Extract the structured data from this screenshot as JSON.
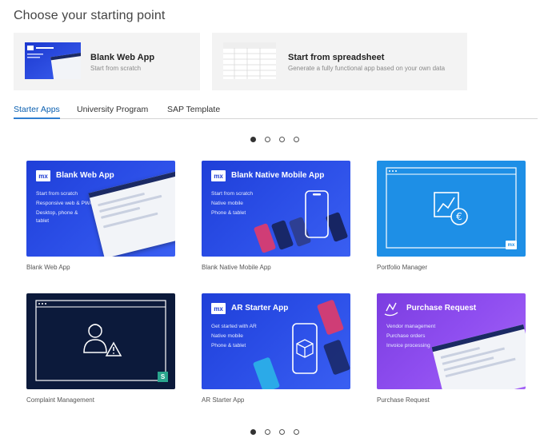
{
  "page_title": "Choose your starting point",
  "start_options": [
    {
      "title": "Blank Web App",
      "subtitle": "Start from scratch"
    },
    {
      "title": "Start from spreadsheet",
      "subtitle": "Generate a fully functional app based on your own data"
    }
  ],
  "tabs": [
    {
      "label": "Starter Apps",
      "active": true
    },
    {
      "label": "University Program",
      "active": false
    },
    {
      "label": "SAP Template",
      "active": false
    }
  ],
  "pager": {
    "pages": 4,
    "current": 1
  },
  "apps": [
    {
      "caption": "Blank Web App",
      "heading": "Blank Web App",
      "badge": "mx",
      "lines": [
        "Start from scratch",
        "Responsive web & PWA",
        "Desktop, phone &",
        "tablet"
      ]
    },
    {
      "caption": "Blank Native Mobile App",
      "heading": "Blank Native Mobile App",
      "badge": "mx",
      "lines": [
        "Start from scratch",
        "Native mobile",
        "Phone & tablet"
      ]
    },
    {
      "caption": "Portfolio Manager",
      "badge": "mx"
    },
    {
      "caption": "Complaint Management",
      "badge": "S"
    },
    {
      "caption": "AR Starter App",
      "heading": "AR Starter App",
      "badge": "mx",
      "lines": [
        "Get started with AR",
        "Native mobile",
        "Phone & tablet"
      ]
    },
    {
      "caption": "Purchase Request",
      "heading": "Purchase Request",
      "lines": [
        "Vendor management",
        "Purchase orders",
        "Invoice processing"
      ]
    }
  ],
  "thumb_badge": "mx",
  "colors": {
    "mendix_blue": "#1f3fd8",
    "portfolio_blue": "#1e8fe6",
    "complaint_navy": "#0c1a3b",
    "purchase_purple": "#8f4ef0",
    "tab_active": "#0a5fb0",
    "card_bg": "#f3f3f3"
  }
}
